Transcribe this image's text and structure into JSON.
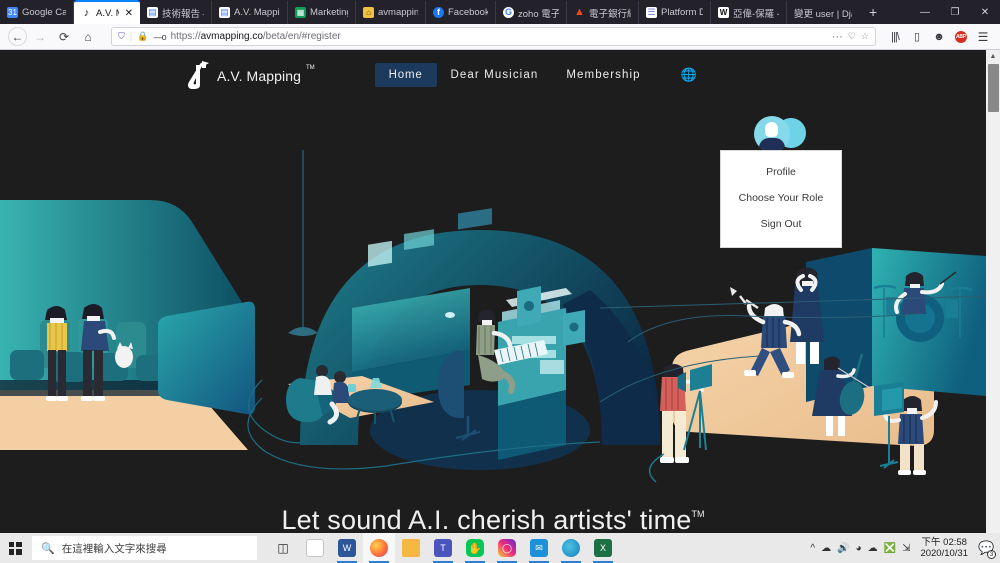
{
  "browser": {
    "tabs": [
      {
        "title": "Google Cale",
        "favicon": "calendar-icon",
        "favcolor": "#4285f4",
        "active": false
      },
      {
        "title": "A.V. Map",
        "favicon": "music-note-icon",
        "favcolor": "#1a1a2e",
        "active": true
      },
      {
        "title": "技術報告 – F",
        "favicon": "doc-icon",
        "favcolor": "#ffffff",
        "active": false
      },
      {
        "title": "A.V. Mappin",
        "favicon": "doc-icon",
        "favcolor": "#ffffff",
        "active": false
      },
      {
        "title": "Marketing T",
        "favicon": "sheets-icon",
        "favcolor": "#0f9d58",
        "active": false
      },
      {
        "title": "avmapping",
        "favicon": "house-icon",
        "favcolor": "#f0c040",
        "active": false
      },
      {
        "title": "Facebook",
        "favicon": "facebook-icon",
        "favcolor": "#1877f2",
        "active": false
      },
      {
        "title": "zoho 電子郵",
        "favicon": "google-icon",
        "favcolor": "#ffffff",
        "active": false
      },
      {
        "title": "電子銀行網]",
        "favicon": "triangle-icon",
        "favcolor": "#e8491d",
        "active": false
      },
      {
        "title": "Platform De",
        "favicon": "form-icon",
        "favcolor": "#6c7ae0",
        "active": false
      },
      {
        "title": "亞偉-保羅 - ",
        "favicon": "wikipedia-icon",
        "favcolor": "#ffffff",
        "active": false
      },
      {
        "title": "變更 user | Djang",
        "favicon": "none",
        "favcolor": "#2b2a33",
        "active": false
      }
    ],
    "newtab_label": "+",
    "window_buttons": {
      "minimize": "—",
      "maximize": "❐",
      "close": "✕"
    },
    "nav": {
      "back": "←",
      "forward": "→",
      "reload": "⟳",
      "home": "⌂",
      "shield_icon": "shield-icon",
      "lock_icon": "lock-icon",
      "perm_icon": "permissions-icon",
      "url_prefix": "https://",
      "url_domain": "avmapping.co",
      "url_path": "/beta/en/#register",
      "more": "···",
      "pocket": "pocket-icon",
      "bookmark": "★",
      "library": "library-icon",
      "sidebar": "sidebar-icon",
      "account": "account-icon",
      "adblock": "ABP",
      "menu": "☰"
    }
  },
  "site": {
    "logo_text": "A.V. Mapping",
    "logo_tm": "TM",
    "nav_items": [
      {
        "label": "Home",
        "active": true
      },
      {
        "label": "Dear Musician",
        "active": false
      },
      {
        "label": "Membership",
        "active": false
      }
    ],
    "language_icon": "globe-icon",
    "avatar_icon": "user-avatar",
    "dropdown": {
      "items": [
        {
          "label": "Profile"
        },
        {
          "label": "Choose Your Role"
        },
        {
          "label": "Sign Out"
        }
      ]
    },
    "tagline": "Let sound A.I. cherish artists' time",
    "tagline_tm": "TM",
    "colors": {
      "page_bg": "#1d1d1d",
      "nav_active": "#1b3a5e",
      "teal": "#3bb3b0",
      "deep_teal": "#1d6e84",
      "sand": "#f3cfa3",
      "navy": "#123a5a"
    }
  },
  "taskbar": {
    "start_icon": "windows-start-icon",
    "search_placeholder": "在這裡輸入文字來搜尋",
    "search_icon": "search-icon",
    "taskview_icon": "task-view-icon",
    "apps": [
      {
        "name": "notepad-icon",
        "glyph": "",
        "color": "#ffffff",
        "open": false
      },
      {
        "name": "word-icon",
        "glyph": "",
        "color": "#2b579a",
        "open": true
      },
      {
        "name": "firefox-icon",
        "glyph": "",
        "color": "#ff7139",
        "open": true
      },
      {
        "name": "file-explorer-icon",
        "glyph": "",
        "color": "#f5b942",
        "open": false
      },
      {
        "name": "teams-icon",
        "glyph": "",
        "color": "#4b53bc",
        "open": true
      },
      {
        "name": "line-icon",
        "glyph": "",
        "color": "#06c755",
        "open": true
      },
      {
        "name": "instagram-icon",
        "glyph": "",
        "color": "#dd2a7b",
        "open": true
      },
      {
        "name": "mail-icon",
        "glyph": "",
        "color": "#1e90d8",
        "open": true
      },
      {
        "name": "edge-icon",
        "glyph": "",
        "color": "#0f7ebf",
        "open": true
      },
      {
        "name": "excel-icon",
        "glyph": "",
        "color": "#1d7044",
        "open": true
      }
    ],
    "tray": {
      "chevron": "^",
      "icons": [
        "onedrive-icon",
        "speaker-icon",
        "wifi-icon",
        "cloud-icon",
        "cancel-icon",
        "tablet-icon"
      ],
      "time": "下午 02:58",
      "date": "2020/10/31",
      "notification_count": "3"
    }
  }
}
